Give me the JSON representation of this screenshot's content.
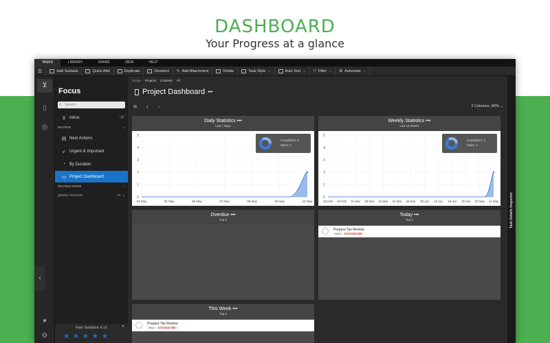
{
  "hero": {
    "title": "DASHBOARD",
    "subtitle": "Your Progress at a glance"
  },
  "menubar": {
    "items": [
      "TASKS",
      "LIBRARY",
      "SHARE",
      "VIEW",
      "HELP"
    ]
  },
  "toolbar": {
    "add_subtask": "Add Subtask",
    "quick_add": "Quick Add",
    "duplicate": "Duplicate",
    "deselect": "Deselect",
    "add_attachment": "Add Attachment",
    "delete": "Delete",
    "task_style": "Task Style",
    "auto_sort": "Auto Sort",
    "filter": "Filter",
    "automate": "Automate"
  },
  "sidebar": {
    "title": "Focus",
    "search_placeholder": "Search",
    "inbox": {
      "label": "Inbox",
      "count": "1"
    },
    "review_header": "REVIEW",
    "items": [
      "Next Actions",
      "Urgent & Important",
      "By Duration",
      "Project Dashboard"
    ],
    "review_more": "REVIEW MORE",
    "quick_access": "QUICK ACCESS",
    "rate": {
      "label": "Rate Taskfabric 4.10",
      "stars": 5
    }
  },
  "main": {
    "breadcrumbs": [
      "Scope",
      "Projects",
      "Contexts",
      "All"
    ],
    "title": "Project Dashboard",
    "more": "•••",
    "columns": "2 Columns, 80%",
    "inspector_label": "Task Details Inspector"
  },
  "panels": {
    "daily": {
      "title": "Daily Statistics",
      "subtitle": "Last 7 Days",
      "legend_completed": "Completed: 2",
      "legend_open": "Open: 1"
    },
    "weekly": {
      "title": "Weekly Statistics",
      "subtitle": "Last 13 Weeks",
      "legend_completed": "Completed: 2",
      "legend_open": "Open: 1"
    },
    "overdue": {
      "title": "Overdue",
      "subtitle": "Top 6"
    },
    "today": {
      "title": "Today",
      "subtitle": "Top 6",
      "task": {
        "name": "Prepare Tax Review",
        "tag": "Inbox",
        "date": "07/07/2020 SBE"
      }
    },
    "this_week": {
      "title": "This Week",
      "subtitle": "Top 6",
      "task": {
        "name": "Prepare Tax Review",
        "tag": "Inbox",
        "date": "07/07/2020 SBE"
      }
    }
  },
  "chart_data": [
    {
      "type": "area",
      "categories": [
        "04 May",
        "05 May",
        "06 May",
        "07 May",
        "08 May",
        "09 May",
        "10 May"
      ],
      "values": [
        0,
        0,
        0,
        0,
        0,
        0,
        2
      ],
      "yticks": [
        0,
        1,
        2,
        3,
        4,
        5
      ],
      "ylim": [
        0,
        5
      ],
      "color": "#8fb4ea"
    },
    {
      "type": "area",
      "categories": [
        "16 Feb",
        "23 Feb",
        "01 Mar",
        "08 Mar",
        "15 Mar",
        "22 Mar",
        "29 Mar",
        "05 Apr",
        "12 Apr",
        "19 Apr",
        "26 Apr",
        "03 May",
        "11 May"
      ],
      "values": [
        0,
        0,
        0,
        0,
        0,
        0,
        0,
        0,
        0,
        0,
        0,
        0,
        2
      ],
      "yticks": [
        0,
        1,
        2,
        3,
        4,
        5
      ],
      "ylim": [
        0,
        5
      ],
      "color": "#8fb4ea"
    }
  ]
}
